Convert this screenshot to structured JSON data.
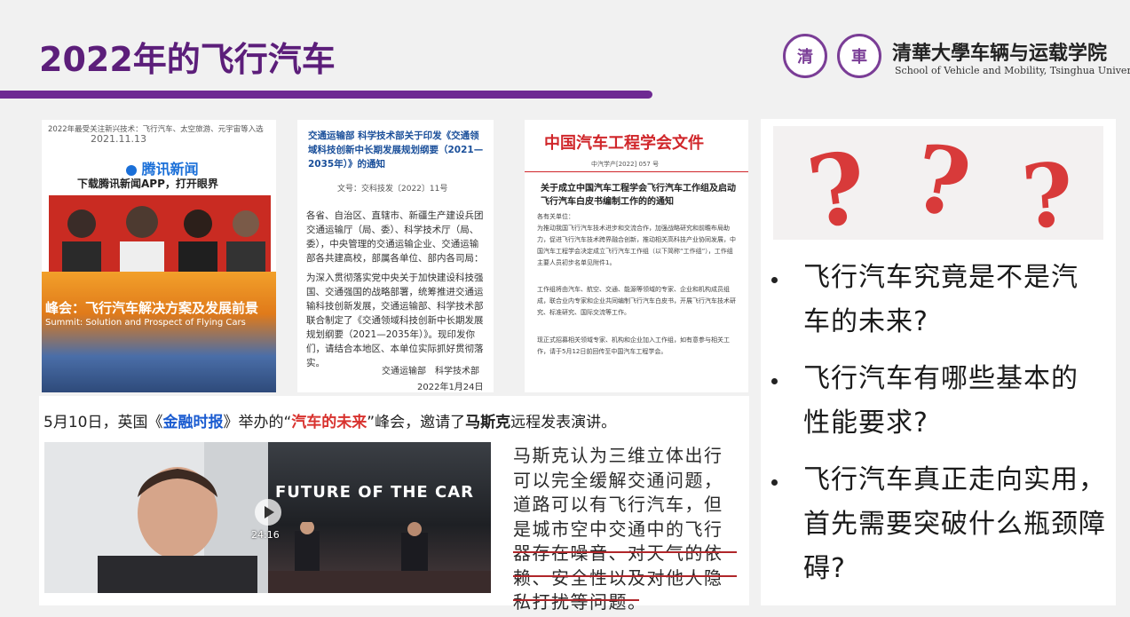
{
  "slide": {
    "title": "2022年的飞行汽车",
    "university": {
      "name": "清華大學车辆与运载学院",
      "subtitle": "School of Vehicle and Mobility, Tsinghua University",
      "logo1_text": "清",
      "logo2_text": "車"
    }
  },
  "panels": {
    "tencent": {
      "headline": "2022年最受关注新兴技术：飞行汽车、太空旅游、元宇宙等入选",
      "date": "2021.11.13",
      "brand": "腾讯新闻",
      "slogan": "下载腾讯新闻APP，打开眼界",
      "banner_text": "峰会：飞行汽车解决方案及发展前景",
      "banner_en": "Summit: Solution and Prospect of Flying Cars"
    },
    "ministry": {
      "title": "交通运输部 科学技术部关于印发《交通领域科技创新中长期发展规划纲要（2021—2035年）》的通知",
      "doc_no": "文号：交科技发〔2022〕11号",
      "para1": "各省、自治区、直辖市、新疆生产建设兵团交通运输厅（局、委）、科学技术厅（局、委），中央管理的交通运输企业、交通运输部各共建高校，部属各单位、部内各司局：",
      "para2": "为深入贯彻落实党中央关于加快建设科技强国、交通强国的战略部署，统筹推进交通运输科技创新发展，交通运输部、科学技术部联合制定了《交通领域科技创新中长期发展规划纲要（2021—2035年）》。现印发你们，请结合本地区、本单位实际抓好贯彻落实。",
      "signature": "交通运输部　科学技术部",
      "date": "2022年1月24日"
    },
    "saec": {
      "header": "中国汽车工程学会文件",
      "doc_no": "中汽学产[2022] 057 号",
      "title": "关于成立中国汽车工程学会飞行汽车工作组及启动飞行汽车白皮书编制工作的的通知",
      "greeting": "各有关单位：",
      "body1": "为推动我国飞行汽车技术进步和交流合作，加强战略研究和前瞻布局助力，促进飞行汽车技术跨界融合创新，推动相关高科技产业协同发展，中国汽车工程学会决定成立飞行汽车工作组（以下简称“工作组”），工作组主要人员初步名单见附件1。",
      "body2": "工作组将由汽车、航空、交通、能源等领域的专家、企业和机构成员组成，联合业内专家和企业共同编制飞行汽车白皮书，开展飞行汽车技术研究、标准研究、国际交流等工作。",
      "body3": "现正式招募相关领域专家、机构和企业加入工作组，如有意参与相关工作，请于5月12日前回传至中国汽车工程学会。"
    },
    "questions": {
      "marks": "???",
      "items": [
        "飞行汽车究竟是不是汽车的未来?",
        "飞行汽车有哪些基本的性能要求?",
        "飞行汽车真正走向实用，首先需要突破什么瓶颈障碍?"
      ]
    }
  },
  "caption": {
    "part1": "5月10日，英国《",
    "ft": "金融时报",
    "part2": "》举办的“",
    "future": "汽车的未来",
    "part3": "”峰会，邀请了",
    "musk": "马斯克",
    "part4": "远程发表演讲。"
  },
  "video": {
    "stage_title": "FUTURE OF THE CAR",
    "timestamp": "24:16"
  },
  "musk_quote": "马斯克认为三维立体出行可以完全缓解交通问题，道路可以有飞行汽车，但是城市空中交通中的飞行器存在噪音、对天气的依赖、安全性以及对他人隐私打扰等问题。",
  "colors": {
    "title": "#5c1e7a",
    "bar": "#6e2a92",
    "red_highlight": "#d8322e",
    "blue_highlight": "#1a5bd0"
  }
}
